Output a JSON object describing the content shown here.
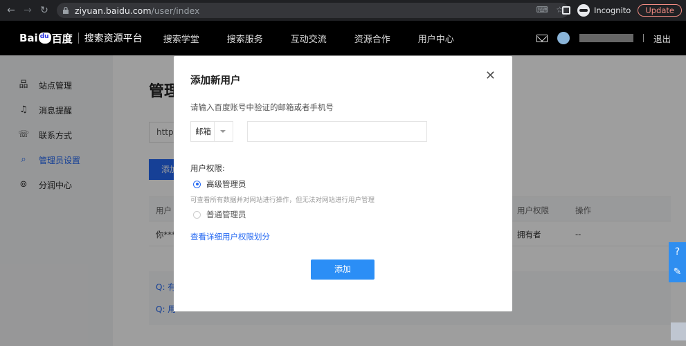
{
  "browser": {
    "host": "ziyuan.baidu.com",
    "path": "/user/index",
    "profile_label": "Incognito",
    "update_label": "Update"
  },
  "header": {
    "logo_text": "Bai",
    "logo_suffix": "百度",
    "platform": "搜索资源平台",
    "nav": [
      "搜索学堂",
      "搜索服务",
      "互动交流",
      "资源合作",
      "用户中心"
    ],
    "logout": "退出"
  },
  "sidebar": {
    "items": [
      {
        "label": "站点管理",
        "icon": "sitemap-icon",
        "glyph": "品"
      },
      {
        "label": "消息提醒",
        "icon": "bell-icon",
        "glyph": "♫"
      },
      {
        "label": "联系方式",
        "icon": "phone-icon",
        "glyph": "☏"
      },
      {
        "label": "管理员设置",
        "icon": "admin-icon",
        "glyph": "⌕"
      },
      {
        "label": "分润中心",
        "icon": "revenue-icon",
        "glyph": "⊚"
      }
    ],
    "active_index": 3
  },
  "main": {
    "title": "管理",
    "site_value": "https:",
    "add_label": "添加",
    "table_headers": [
      "用户",
      "用户权限",
      "操作"
    ],
    "table_row": {
      "user": "你***",
      "permission": "拥有者",
      "action": "--"
    },
    "faq": [
      "Q: 有",
      "Q: 用"
    ]
  },
  "modal": {
    "title": "添加新用户",
    "hint": "请输入百度账号中验证的邮箱或者手机号",
    "account_type": "邮箱",
    "account_value": "",
    "permission_label": "用户权限:",
    "options": [
      {
        "label": "高级管理员",
        "checked": true
      },
      {
        "label": "普通管理员",
        "checked": false
      }
    ],
    "senior_desc": "可查看所有数据并对网站进行操作，但无法对网站进行用户管理",
    "detail_link": "查看详细用户权限划分",
    "confirm_label": "添加"
  },
  "colors": {
    "accent": "#2468f2",
    "button": "#2b8ef6",
    "header_bg": "#000000"
  }
}
